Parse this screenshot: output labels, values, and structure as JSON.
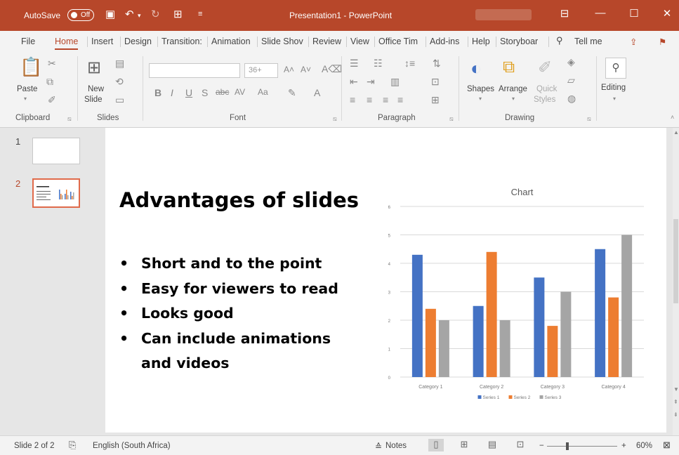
{
  "titlebar": {
    "autosave": "AutoSave",
    "autosave_state": "Off",
    "title": "Presentation1  -  PowerPoint"
  },
  "tabs": [
    "File",
    "Home",
    "Insert",
    "Design",
    "Transition:",
    "Animation",
    "Slide Shov",
    "Review",
    "View",
    "Office Tim",
    "Add-ins",
    "Help",
    "Storyboar"
  ],
  "tell_me": "Tell me",
  "ribbon": {
    "paste": "Paste",
    "new_slide_1": "New",
    "new_slide_2": "Slide",
    "font_size": "36+",
    "shapes": "Shapes",
    "arrange": "Arrange",
    "quick_styles_1": "Quick",
    "quick_styles_2": "Styles",
    "editing": "Editing",
    "groups": {
      "clipboard": "Clipboard",
      "slides": "Slides",
      "font": "Font",
      "paragraph": "Paragraph",
      "drawing": "Drawing"
    }
  },
  "thumbs": [
    "1",
    "2"
  ],
  "slide": {
    "title": "Advantages of slides",
    "bullets": [
      "Short and to the point",
      "Easy for viewers to read",
      "Looks good",
      "Can include animations and videos"
    ]
  },
  "chart_data": {
    "type": "bar",
    "title": "Chart",
    "categories": [
      "Category 1",
      "Category 2",
      "Category 3",
      "Category 4"
    ],
    "series": [
      {
        "name": "Series 1",
        "values": [
          4.3,
          2.5,
          3.5,
          4.5
        ],
        "color": "#4472c4"
      },
      {
        "name": "Series 2",
        "values": [
          2.4,
          4.4,
          1.8,
          2.8
        ],
        "color": "#ed7d31"
      },
      {
        "name": "Series 3",
        "values": [
          2,
          2,
          3,
          5
        ],
        "color": "#a5a5a5"
      }
    ],
    "ylim": [
      0,
      6
    ],
    "yticks": [
      0,
      1,
      2,
      3,
      4,
      5,
      6
    ],
    "grid": true,
    "legend": "bottom"
  },
  "status": {
    "slide_count": "Slide 2 of 2",
    "language": "English (South Africa)",
    "notes": "Notes",
    "zoom": "60%"
  },
  "colors": {
    "accent": "#b7472a",
    "ribbon_bg": "#f3f3f3"
  }
}
